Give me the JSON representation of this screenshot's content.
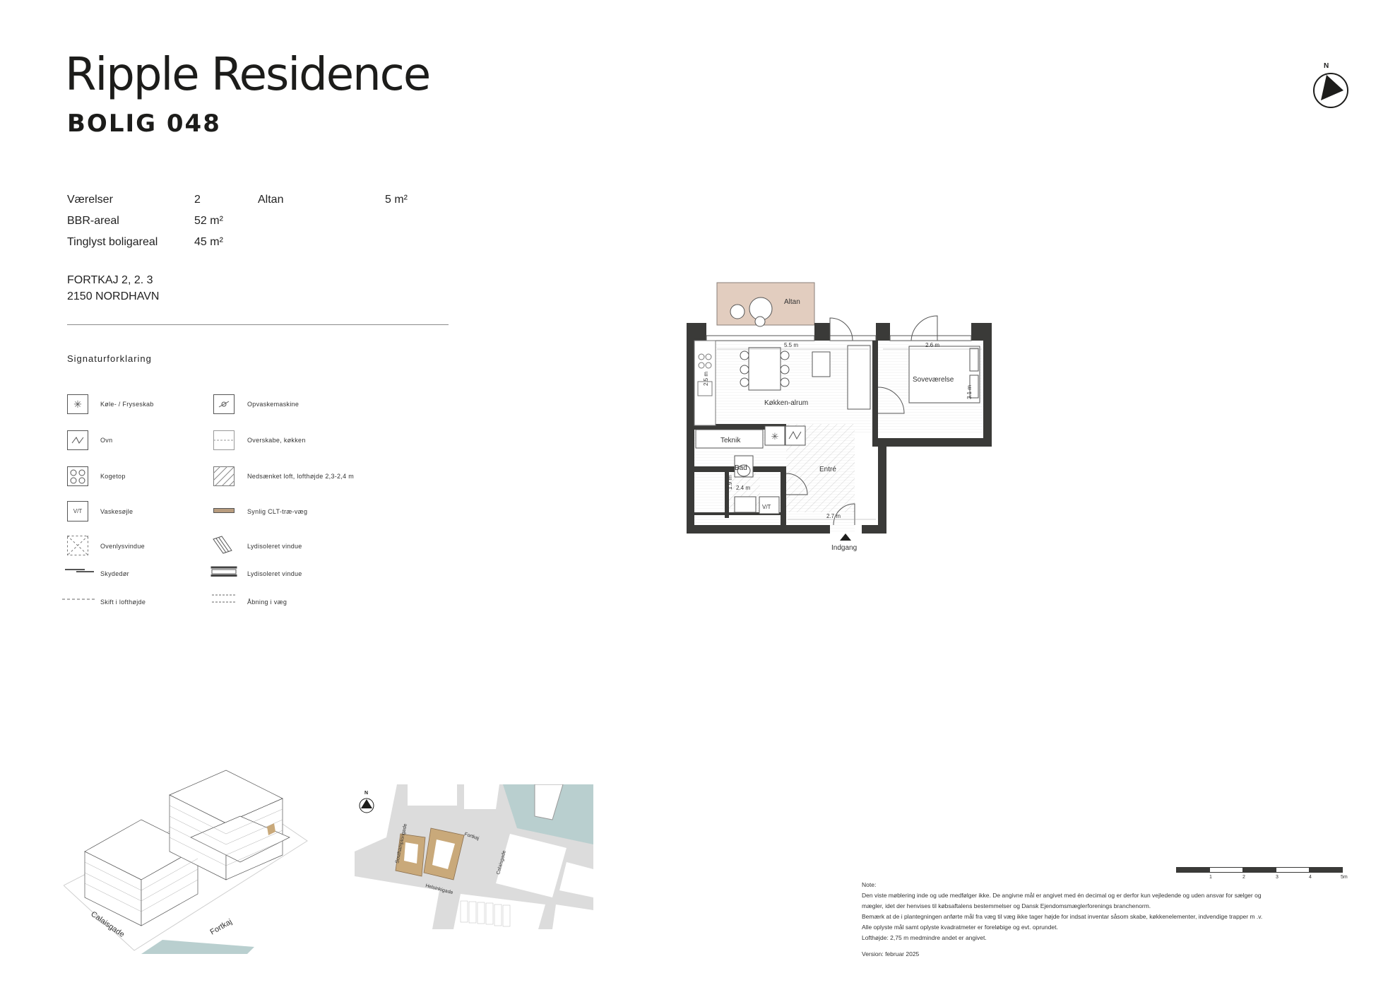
{
  "header": {
    "title": "Ripple Residence",
    "subtitle": "BOLIG 048"
  },
  "facts": [
    {
      "label": "Værelser",
      "value": "2"
    },
    {
      "label": "BBR-areal",
      "value": "52 m²"
    },
    {
      "label": "Tinglyst boligareal",
      "value": "45 m²"
    }
  ],
  "facts_extra": {
    "label": "Altan",
    "value": "5 m²"
  },
  "address": {
    "line1": "FORTKAJ 2, 2. 3",
    "line2": "2150 NORDHAVN"
  },
  "legend": {
    "heading": "Signaturforklaring",
    "left": [
      {
        "label": "Køle- / Fryseskab",
        "icon": "fridge-icon"
      },
      {
        "label": "Ovn",
        "icon": "oven-icon"
      },
      {
        "label": "Kogetop",
        "icon": "cooktop-icon"
      },
      {
        "label": "Vaskesøjle",
        "icon": "washer-column-icon",
        "icon_text": "V/T"
      },
      {
        "label": "Ovenlysvindue",
        "icon": "skylight-icon"
      },
      {
        "label": "Skydedør",
        "icon": "sliding-door-icon"
      },
      {
        "label": "Skift i lofthøjde",
        "icon": "ceiling-change-icon"
      }
    ],
    "right": [
      {
        "label": "Opvaskemaskine",
        "icon": "dishwasher-icon"
      },
      {
        "label": "Overskabe, køkken",
        "icon": "wall-cabinet-icon"
      },
      {
        "label": "Nedsænket loft, lofthøjde 2,3-2,4 m",
        "icon": "lowered-ceiling-icon"
      },
      {
        "label": "Synlig CLT-træ-væg",
        "icon": "clt-wall-icon"
      },
      {
        "label": "Lydisoleret vindue",
        "icon": "soundproof-window-icon"
      },
      {
        "label": "Lydisoleret vindue",
        "icon": "soundproof-window-2-icon"
      },
      {
        "label": "Åbning i væg",
        "icon": "wall-opening-icon"
      }
    ]
  },
  "floorplan": {
    "rooms": {
      "altan": "Altan",
      "kitchen": "Køkken-alrum",
      "bedroom": "Soveværelse",
      "teknik": "Teknik",
      "bad": "Bad",
      "entre": "Entré",
      "vt": "V/T"
    },
    "dimensions": {
      "kitchen_width": "5.5 m",
      "kitchen_depth": "2.5 m",
      "bedroom_width": "2.6 m",
      "bedroom_depth": "3.1 m",
      "bad_width": "2.4 m",
      "bad_depth": "1.9 m",
      "entre_width": "2.7 m"
    },
    "entrance_label": "Indgang",
    "north_label": "N"
  },
  "sitemap": {
    "north_label": "N",
    "streets": [
      "Southamptongade",
      "Fortkaj",
      "Calaisgade",
      "Helsinkigade"
    ]
  },
  "axonometric": {
    "streets": [
      "Calaisgade",
      "Fortkaj"
    ]
  },
  "scalebar": {
    "labels": [
      "1",
      "2",
      "3",
      "4",
      "5m"
    ]
  },
  "notes": {
    "heading": "Note:",
    "lines": [
      "Den viste møblering inde og ude medfølger ikke. De angivne mål er angivet med én decimal og er derfor kun vejledende og uden ansvar for sælger og",
      "mægler, idet der henvises til købsaftalens bestemmelser og Dansk Ejendomsmæglerforenings branchenorm.",
      "Bemærk at de i plantegningen anførte mål fra væg til væg ikke tager højde for indsat inventar såsom skabe, køkkenelementer, indvendige trapper m .v.",
      "Alle oplyste mål samt oplyste kvadratmeter er foreløbige og evt. oprundet.",
      "Lofthøjde: 2,75 m medmindre andet er angivet."
    ],
    "version": "Version: februar 2025"
  },
  "colors": {
    "wall": "#3a3a38",
    "balcony": "#e2cdbf",
    "clt": "#b89c7e",
    "site_building": "#c9a97a",
    "water": "#b9cfcf",
    "street": "#dcdcdc"
  }
}
